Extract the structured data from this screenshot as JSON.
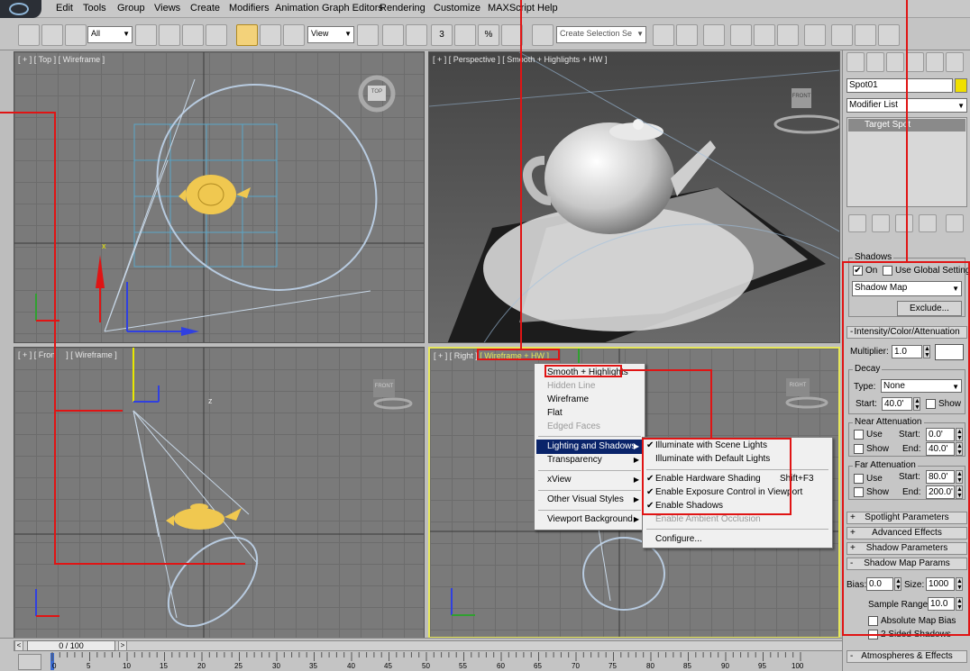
{
  "menubar": {
    "items": [
      "Edit",
      "Tools",
      "Group",
      "Views",
      "Create",
      "Modifiers",
      "Animation",
      "Graph Editors",
      "Rendering",
      "Customize",
      "MAXScript",
      "Help"
    ]
  },
  "toolbar": {
    "selection_filter": "All",
    "ref_coord": "View",
    "named_selection_placeholder": "Create Selection Se",
    "snap_labels": [
      "3",
      "%"
    ]
  },
  "viewports": {
    "top": "[ + ] [ Top ] [ Wireframe ]",
    "perspective": "[ + ] [ Perspective ] [ Smooth + Highlights + HW ]",
    "front_prefix": "[ + ] [ Fron",
    "front_suffix": "] [ Wireframe ]",
    "right_prefix": "[ + ] [ Right ]",
    "right_shading": "[ Wireframe + HW ]",
    "cube_top": "TOP",
    "cube_front": "FRONT",
    "cube_right": "RIGHT"
  },
  "context_menu": {
    "items": [
      {
        "label": "Smooth + Highlights",
        "state": "normal"
      },
      {
        "label": "Hidden Line",
        "state": "disabled"
      },
      {
        "label": "Wireframe",
        "state": "normal"
      },
      {
        "label": "Flat",
        "state": "normal"
      },
      {
        "label": "Edged Faces",
        "state": "disabled"
      },
      {
        "label": "Lighting and Shadows",
        "state": "selected"
      },
      {
        "label": "Transparency",
        "state": "normal"
      },
      {
        "label": "xView",
        "state": "normal"
      },
      {
        "label": "Other Visual Styles",
        "state": "normal"
      },
      {
        "label": "Viewport Background",
        "state": "normal"
      }
    ]
  },
  "submenu": {
    "items": [
      {
        "label": "Illuminate with Scene Lights",
        "checked": true,
        "state": "normal",
        "shortcut": ""
      },
      {
        "label": "Illuminate with Default Lights",
        "checked": false,
        "state": "normal",
        "shortcut": ""
      },
      {
        "label": "Enable Hardware Shading",
        "checked": true,
        "state": "normal",
        "shortcut": "Shift+F3"
      },
      {
        "label": "Enable Exposure Control in Viewport",
        "checked": true,
        "state": "normal",
        "shortcut": ""
      },
      {
        "label": "Enable Shadows",
        "checked": true,
        "state": "normal",
        "shortcut": ""
      },
      {
        "label": "Enable Ambient Occlusion",
        "checked": false,
        "state": "disabled",
        "shortcut": ""
      },
      {
        "label": "Configure...",
        "checked": false,
        "state": "normal",
        "shortcut": ""
      }
    ]
  },
  "command_panel": {
    "object_name": "Spot01",
    "modifier_list": "Modifier List",
    "stack_item": "Target Spot",
    "shadows": {
      "title": "Shadows",
      "on_label": "On",
      "on_checked": true,
      "global_label": "Use Global Settings",
      "global_checked": false,
      "type": "Shadow Map",
      "exclude": "Exclude..."
    },
    "intensity": {
      "title": "Intensity/Color/Attenuation",
      "multiplier_label": "Multiplier:",
      "multiplier": "1.0",
      "decay_title": "Decay",
      "type_label": "Type:",
      "type": "None",
      "start_label": "Start:",
      "start": "40.0'",
      "show_label": "Show",
      "near_title": "Near Attenuation",
      "use_label": "Use",
      "near_start_label": "Start:",
      "near_start": "0.0'",
      "end_label": "End:",
      "near_end": "40.0'",
      "far_title": "Far Attenuation",
      "far_start_label": "Start:",
      "far_start": "80.0'",
      "far_end_label": "End:",
      "far_end": "200.0'"
    },
    "rollouts": [
      {
        "sign": "+",
        "label": "Spotlight Parameters"
      },
      {
        "sign": "+",
        "label": "Advanced Effects"
      },
      {
        "sign": "+",
        "label": "Shadow Parameters"
      },
      {
        "sign": "-",
        "label": "Shadow Map Params"
      }
    ],
    "shadow_map": {
      "bias_label": "Bias:",
      "bias": "0.0",
      "size_label": "Size:",
      "size": "1000",
      "sample_label": "Sample Range:",
      "sample": "10.0",
      "abs_label": "Absolute Map Bias",
      "two_sided_label": "2 Sided Shadows"
    },
    "atmos": {
      "sign": "-",
      "label": "Atmospheres & Effects"
    }
  },
  "timeline": {
    "frame": "0 / 100",
    "ticks": [
      "0",
      "5",
      "10",
      "15",
      "20",
      "25",
      "30",
      "35",
      "40",
      "45",
      "50",
      "55",
      "60",
      "65",
      "70",
      "75",
      "80",
      "85",
      "90",
      "95",
      "100"
    ]
  },
  "colors": {
    "annotation": "#e01414",
    "active_viewport": "#e6e65a",
    "teapot": "#f0c850",
    "menu_highlight": "#0a246a"
  }
}
